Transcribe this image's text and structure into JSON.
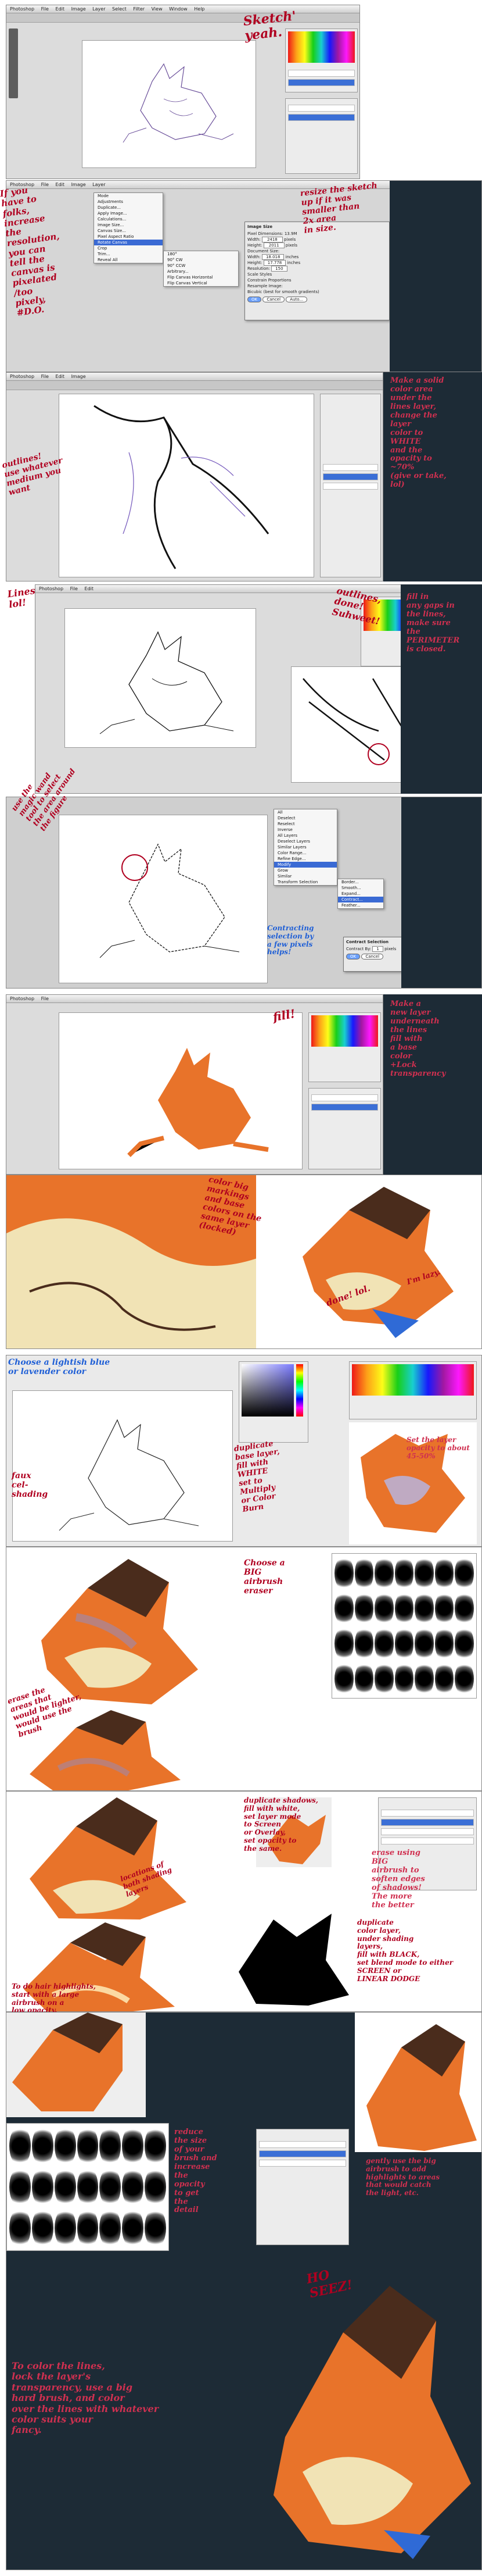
{
  "colors": {
    "annotation": "#b00020",
    "annotation_blue": "#1f5fd6",
    "dark_bg": "#1d2b36",
    "fur_orange": "#e8732a",
    "fur_light": "#f1e3b5",
    "fur_dark": "#4a2c1c",
    "selection": "#3b6fd6"
  },
  "app": {
    "name": "Photoshop",
    "menu": [
      "Photoshop",
      "File",
      "Edit",
      "Image",
      "Layer",
      "Select",
      "Filter",
      "View",
      "Window",
      "Help"
    ]
  },
  "image_menu": {
    "items": [
      "Mode",
      "Adjustments",
      "Duplicate...",
      "Apply Image...",
      "Calculations...",
      "Image Size...",
      "Canvas Size...",
      "Pixel Aspect Ratio",
      "Rotate Canvas",
      "Crop",
      "Trim...",
      "Reveal All"
    ],
    "submenu": [
      "180°",
      "90° CW",
      "90° CCW",
      "Arbitrary...",
      "Flip Canvas Horizontal",
      "Flip Canvas Vertical"
    ]
  },
  "image_size_dialog": {
    "title": "Image Size",
    "pixel_dimensions": "Pixel Dimensions: 13.9M",
    "width_label": "Width:",
    "width_value": "2418",
    "height_label": "Height:",
    "height_value": "2011",
    "doc_size": "Document Size:",
    "doc_width": "18.018",
    "doc_height": "17.778",
    "resolution_label": "Resolution:",
    "resolution_value": "150",
    "units_px": "pixels",
    "units_in": "inches",
    "checks": [
      "Scale Styles",
      "Constrain Proportions",
      "Resample Image:"
    ],
    "resample": "Bicubic (best for smooth gradients)",
    "ok": "OK",
    "cancel": "Cancel",
    "auto": "Auto..."
  },
  "contract_dialog": {
    "title": "Contract Selection",
    "label": "Contract By:",
    "value": "1",
    "unit": "pixels",
    "ok": "OK",
    "cancel": "Cancel"
  },
  "select_menu": {
    "items": [
      "All",
      "Deselect",
      "Reselect",
      "Inverse",
      "All Layers",
      "Deselect Layers",
      "Similar Layers",
      "Color Range...",
      "Refine Edge...",
      "Modify",
      "Grow",
      "Similar",
      "Transform Selection"
    ],
    "modify": [
      "Border...",
      "Smooth...",
      "Expand...",
      "Contract...",
      "Feather..."
    ]
  },
  "notes": {
    "n1": "Sketch'\nyeah.",
    "n2": "If you\nhave to\nfolks,\nincrease\nthe\nresolution,\nyou can\ntell the\ncanvas is\npixelated\n/too\npixely,\n#D.O.",
    "n3": "resize the sketch\nup if it was\nsmaller than\n2x area\nin size.",
    "n4": "Make a solid\ncolor area\nunder the\nlines layer,\nchange the\nlayer\ncolor to\nWHITE\nand the\nopacity to\n~70%\n(give or take,\nlol)",
    "n5": "outlines!\nuse whatever\nmedium you\nwant",
    "n6": "Lines\nlol!",
    "n7": "outlines,\ndone!\nSuhweet!",
    "n8": "fill in\nany gaps in\nthe lines,\nmake sure\nthe\nPERIMETER\nis closed.",
    "n9": "use the\nmagic wand\ntool to select\nthe area around\nthe figure",
    "n10": "Contracting\nselection by\na few pixels\nhelps!",
    "n11": "Make a\nnew layer\nunderneath\nthe lines\nfill with\na base\ncolor\n+Lock\ntransparency",
    "n12": "fill!",
    "n13": "color big\nmarkings\nand base\ncolors on the\nsame layer\n(locked)",
    "n14": "done! lol.",
    "n15": "I'm lazy.",
    "n16": "Choose a lightish blue\nor lavender color",
    "n17": "duplicate\nbase layer,\nfill with\nWHITE\nset to\nMultiply\nor Color\nBurn",
    "n18": "Set the layer\nopacity to about\n45-50%",
    "n19": "faux\ncel-\nshading",
    "n20": "Choose a\nBIG\nairbrush\neraser",
    "n21": "erase the\nareas that\nwould be lighter,\nwould use the\nbrush",
    "n22": "duplicate shadows,\nfill with white,\nset layer mode\nto Screen\nor Overlay,\nset opacity to\nthe same.",
    "n23": "erase using\nBIG\nairbrush to\nsoften edges\nof shadows!\nThe more\nthe better",
    "n24": "locations of\nboth shading\nlayers",
    "n25": "duplicate\ncolor layer,\nunder shading\nlayers,\nfill with BLACK,\nset blend mode to either\nSCREEN or\nLINEAR DODGE",
    "n26": "To do hair highlights,\nstart with a large\nairbrush on a\nlow opacity.",
    "n27": "reduce\nthe size\nof your\nbrush and\nincrease\nthe\nopacity\nto get\nthe\ndetail",
    "n28": "gently use the big\nairbrush to add\nhighlights to areas\nthat would catch\nthe light, etc.",
    "n29": "HO\nSEEZ!",
    "n30": "To color the lines,\nlock the layer's\ntransparency, use a big\nhard brush, and color\nover the lines with whatever\ncolor suits your\nfancy."
  }
}
